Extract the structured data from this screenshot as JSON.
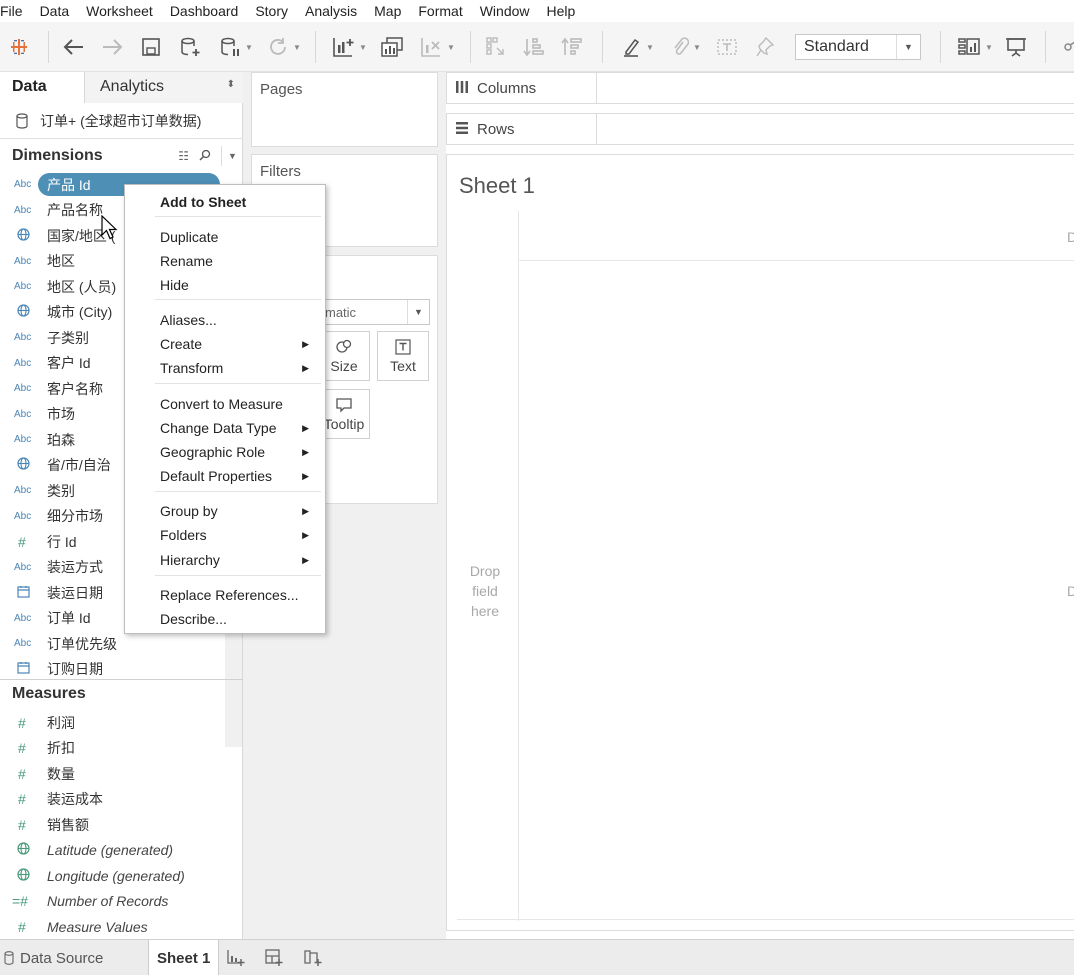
{
  "menu": [
    "File",
    "Data",
    "Worksheet",
    "Dashboard",
    "Story",
    "Analysis",
    "Map",
    "Format",
    "Window",
    "Help"
  ],
  "toolbar": {
    "view_mode": "Standard"
  },
  "data_pane": {
    "tab_data": "Data",
    "tab_analytics": "Analytics",
    "datasource": "订单+ (全球超市订单数据)",
    "dimensions_title": "Dimensions",
    "dimensions": [
      {
        "type": "abc",
        "label": "产品 Id",
        "selected": true
      },
      {
        "type": "abc",
        "label": "产品名称"
      },
      {
        "type": "geo",
        "label": "国家/地区 ("
      },
      {
        "type": "abc",
        "label": "地区"
      },
      {
        "type": "abc",
        "label": "地区 (人员)"
      },
      {
        "type": "geo",
        "label": "城市 (City)"
      },
      {
        "type": "abc",
        "label": "子类别"
      },
      {
        "type": "abc",
        "label": "客户 Id"
      },
      {
        "type": "abc",
        "label": "客户名称"
      },
      {
        "type": "abc",
        "label": "市场"
      },
      {
        "type": "abc",
        "label": "珀森"
      },
      {
        "type": "geo",
        "label": "省/市/自治"
      },
      {
        "type": "abc",
        "label": "类别"
      },
      {
        "type": "abc",
        "label": "细分市场"
      },
      {
        "type": "num",
        "label": "行 Id"
      },
      {
        "type": "abc",
        "label": "装运方式"
      },
      {
        "type": "date",
        "label": "装运日期"
      },
      {
        "type": "abc",
        "label": "订单 Id"
      },
      {
        "type": "abc",
        "label": "订单优先级"
      },
      {
        "type": "date",
        "label": "订购日期"
      }
    ],
    "measures_title": "Measures",
    "measures": [
      {
        "type": "num",
        "label": "利润"
      },
      {
        "type": "num",
        "label": "折扣"
      },
      {
        "type": "num",
        "label": "数量"
      },
      {
        "type": "num",
        "label": "装运成本"
      },
      {
        "type": "num",
        "label": "销售额"
      },
      {
        "type": "geo",
        "label": "Latitude (generated)",
        "italic": true
      },
      {
        "type": "geo",
        "label": "Longitude (generated)",
        "italic": true
      },
      {
        "type": "numcalc",
        "label": "Number of Records",
        "italic": true
      },
      {
        "type": "num",
        "label": "Measure Values",
        "italic": true
      }
    ],
    "type_glyphs": {
      "abc": "Abc",
      "num": "#",
      "numcalc": "=#"
    }
  },
  "cards": {
    "pages": "Pages",
    "filters": "Filters",
    "marks_type": "matic",
    "marks_buttons": [
      "Size",
      "Text",
      "Tooltip"
    ]
  },
  "shelves": {
    "columns": "Columns",
    "rows": "Rows"
  },
  "sheet": {
    "title": "Sheet 1",
    "drop_lines": [
      "Drop",
      "field",
      "here"
    ],
    "edge_label": "D"
  },
  "context_menu": {
    "items": [
      {
        "label": "Add to Sheet",
        "bold": true
      },
      {
        "label": "Duplicate"
      },
      {
        "label": "Rename"
      },
      {
        "label": "Hide"
      },
      {
        "label": "Aliases..."
      },
      {
        "label": "Create",
        "submenu": true
      },
      {
        "label": "Transform",
        "submenu": true
      },
      {
        "label": "Convert to Measure"
      },
      {
        "label": "Change Data Type",
        "submenu": true
      },
      {
        "label": "Geographic Role",
        "submenu": true
      },
      {
        "label": "Default Properties",
        "submenu": true
      },
      {
        "label": "Group by",
        "submenu": true
      },
      {
        "label": "Folders",
        "submenu": true
      },
      {
        "label": "Hierarchy",
        "submenu": true
      },
      {
        "label": "Replace References..."
      },
      {
        "label": "Describe..."
      }
    ]
  },
  "bottom": {
    "datasource_tab": "Data Source",
    "sheet_tab": "Sheet 1"
  },
  "colors": {
    "selected_pill": "#4e8fb5",
    "dimension_icon": "#4a85b8",
    "measure_icon": "#4a9a7b",
    "logo": "#e8733a"
  }
}
